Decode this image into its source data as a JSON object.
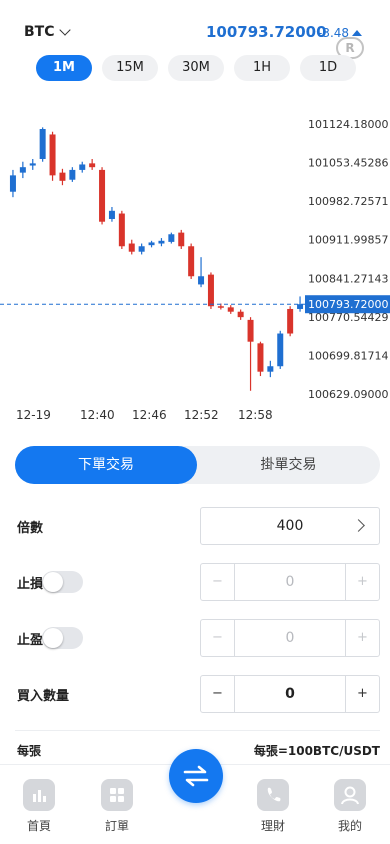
{
  "header": {
    "symbol": "BTC",
    "price": "100793.72000",
    "change": "-3.48"
  },
  "intervals": [
    {
      "label": "1M",
      "active": true
    },
    {
      "label": "15M",
      "active": false
    },
    {
      "label": "30M",
      "active": false
    },
    {
      "label": "1H",
      "active": false
    },
    {
      "label": "1D",
      "active": false
    }
  ],
  "chart_data": {
    "type": "candlestick",
    "y_ticks": [
      "101124.18000",
      "101053.45286",
      "100982.72571",
      "100911.99857",
      "100841.27143",
      "100770.54429",
      "100699.81714",
      "100629.09000"
    ],
    "ylim": [
      100629.09,
      101124.18
    ],
    "x_ticks": [
      "12-19",
      "12:40",
      "12:46",
      "12:52",
      "12:58"
    ],
    "current_price": "100793.72000",
    "up_color": "#1f6fd1",
    "down_color": "#d9342b",
    "candles": [
      {
        "o": 101000,
        "c": 101030,
        "h": 101040,
        "l": 100990
      },
      {
        "o": 101035,
        "c": 101045,
        "h": 101055,
        "l": 101025
      },
      {
        "o": 101048,
        "c": 101052,
        "h": 101060,
        "l": 101040
      },
      {
        "o": 101060,
        "c": 101115,
        "h": 101118,
        "l": 101055
      },
      {
        "o": 101105,
        "c": 101030,
        "h": 101110,
        "l": 101020
      },
      {
        "o": 101035,
        "c": 101020,
        "h": 101042,
        "l": 101012
      },
      {
        "o": 101022,
        "c": 101040,
        "h": 101045,
        "l": 101018
      },
      {
        "o": 101040,
        "c": 101050,
        "h": 101055,
        "l": 101035
      },
      {
        "o": 101052,
        "c": 101045,
        "h": 101060,
        "l": 101040
      },
      {
        "o": 101040,
        "c": 100945,
        "h": 101045,
        "l": 100940
      },
      {
        "o": 100950,
        "c": 100965,
        "h": 100972,
        "l": 100945
      },
      {
        "o": 100960,
        "c": 100900,
        "h": 100965,
        "l": 100895
      },
      {
        "o": 100905,
        "c": 100890,
        "h": 100912,
        "l": 100885
      },
      {
        "o": 100890,
        "c": 100900,
        "h": 100905,
        "l": 100885
      },
      {
        "o": 100902,
        "c": 100907,
        "h": 100910,
        "l": 100898
      },
      {
        "o": 100905,
        "c": 100910,
        "h": 100915,
        "l": 100900
      },
      {
        "o": 100908,
        "c": 100922,
        "h": 100925,
        "l": 100905
      },
      {
        "o": 100925,
        "c": 100900,
        "h": 100930,
        "l": 100895
      },
      {
        "o": 100900,
        "c": 100845,
        "h": 100905,
        "l": 100840
      },
      {
        "o": 100830,
        "c": 100845,
        "h": 100880,
        "l": 100825
      },
      {
        "o": 100848,
        "c": 100790,
        "h": 100852,
        "l": 100785
      },
      {
        "o": 100790,
        "c": 100788,
        "h": 100795,
        "l": 100784
      },
      {
        "o": 100788,
        "c": 100780,
        "h": 100792,
        "l": 100776
      },
      {
        "o": 100780,
        "c": 100770,
        "h": 100784,
        "l": 100765
      },
      {
        "o": 100765,
        "c": 100725,
        "h": 100770,
        "l": 100635
      },
      {
        "o": 100722,
        "c": 100670,
        "h": 100725,
        "l": 100662
      },
      {
        "o": 100670,
        "c": 100680,
        "h": 100690,
        "l": 100660
      },
      {
        "o": 100680,
        "c": 100740,
        "h": 100745,
        "l": 100675
      },
      {
        "o": 100785,
        "c": 100740,
        "h": 100790,
        "l": 100735
      },
      {
        "o": 100785,
        "c": 100793.72,
        "h": 100808,
        "l": 100780
      }
    ]
  },
  "order_tabs": {
    "market": "下單交易",
    "limit": "掛單交易"
  },
  "form": {
    "leverage_label": "倍數",
    "leverage_value": "400",
    "stop_loss_label": "止損",
    "stop_loss_value": "0",
    "take_profit_label": "止盈",
    "take_profit_value": "0",
    "quantity_label": "買入數量",
    "quantity_value": "0",
    "minus": "−",
    "plus": "+",
    "per_lot_label": "每張",
    "per_lot_value": "每張=100BTC/USDT"
  },
  "bottom_nav": {
    "home": "首頁",
    "orders": "訂單",
    "wealth": "理財",
    "mine": "我的"
  },
  "colors": {
    "accent": "#1478f0",
    "price": "#1f6fd1",
    "down": "#d9342b"
  }
}
